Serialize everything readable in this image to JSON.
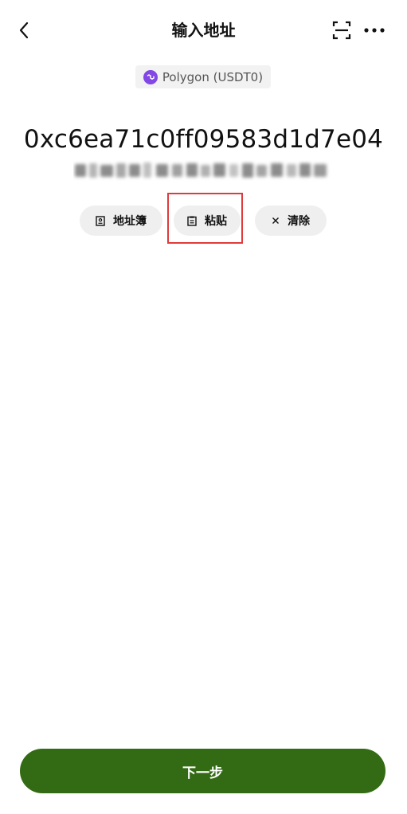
{
  "header": {
    "title": "输入地址",
    "back_icon": "chevron-left-icon",
    "scan_icon": "scan-icon",
    "more_icon": "more-horizontal-icon"
  },
  "network": {
    "label": "Polygon (USDT0)",
    "icon": "polygon-icon",
    "icon_color": "#8247e5"
  },
  "address": {
    "visible_text": "0xc6ea71c0ff09583d1d7e04"
  },
  "actions": {
    "address_book": {
      "label": "地址簿",
      "icon": "contact-book-icon"
    },
    "paste": {
      "label": "粘贴",
      "icon": "clipboard-icon"
    },
    "clear": {
      "label": "清除",
      "icon": "close-icon"
    }
  },
  "footer": {
    "next_label": "下一步",
    "accent_color": "#336b14"
  },
  "highlight_color": "#e03a3a"
}
